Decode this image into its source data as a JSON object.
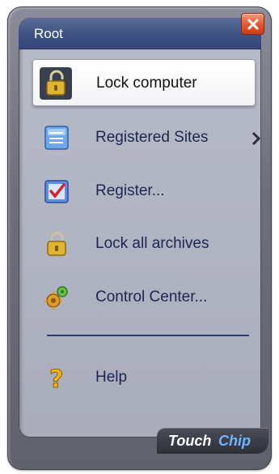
{
  "window": {
    "title": "Root",
    "close_label": "Close"
  },
  "menu": {
    "items": [
      {
        "label": "Lock computer",
        "icon": "lock-icon",
        "selected": true
      },
      {
        "label": "Registered Sites",
        "icon": "sites-list-icon",
        "has_submenu": true
      },
      {
        "label": "Register...",
        "icon": "register-check-icon"
      },
      {
        "label": "Lock all archives",
        "icon": "lock-icon"
      },
      {
        "label": "Control Center...",
        "icon": "control-center-icon"
      }
    ],
    "help": {
      "label": "Help",
      "icon": "question-icon"
    }
  },
  "branding": {
    "logo_part1": "Touch",
    "logo_part2": "Chip"
  },
  "colors": {
    "titlebar": "#3f5282",
    "panel": "#b1b4c2",
    "label": "#1c2750",
    "close": "#e55a33",
    "divider": "#2e3b72"
  }
}
